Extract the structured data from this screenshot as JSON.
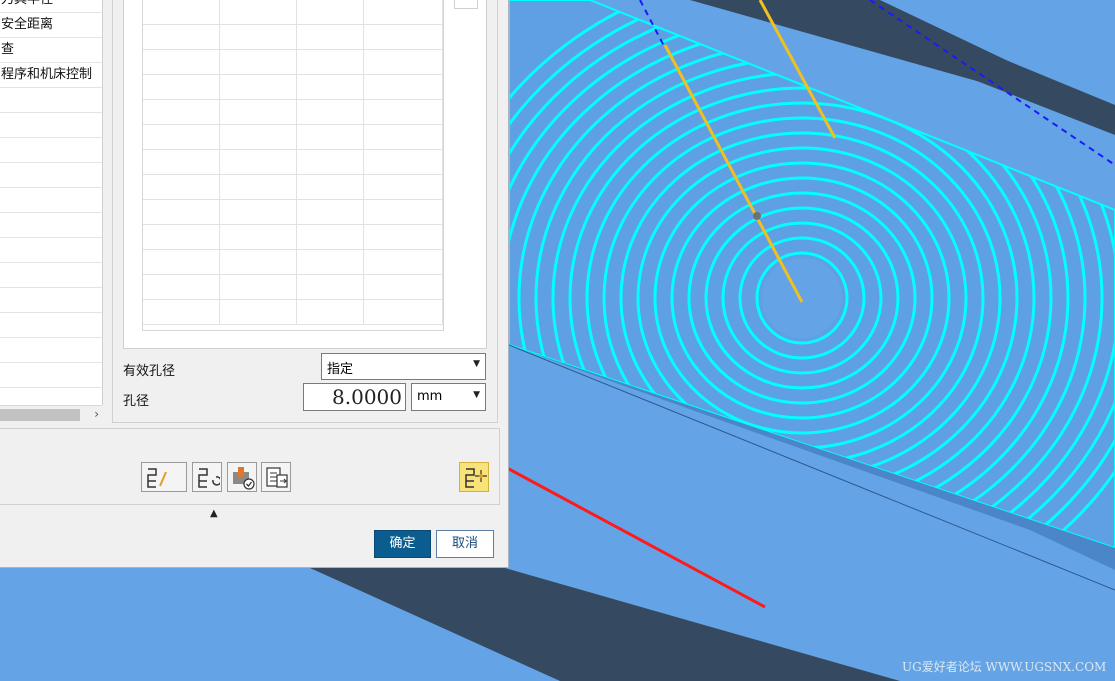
{
  "dialog": {
    "left_list": {
      "items": [
        "刀具半径",
        "安全距离",
        "查",
        "程序和机床控制",
        "",
        "",
        "",
        "",
        "",
        "",
        "",
        "",
        "",
        "",
        "",
        "",
        ""
      ]
    },
    "fields": {
      "effective_hole_label": "有效孔径",
      "effective_hole_value": "指定",
      "hole_diameter_label": "孔径",
      "hole_diameter_value": "8.0000",
      "unit_value": "mm"
    },
    "toolbar": {
      "icons": [
        "generate-icon",
        "replay-icon",
        "verify-icon",
        "list-icon",
        "display-icon"
      ]
    },
    "buttons": {
      "ok_label": "确定",
      "cancel_label": "取消"
    }
  },
  "watermark": "UG爱好者论坛 WWW.UGSNX.COM",
  "colors": {
    "viewport_bg": "#64a4e6",
    "toolpath": "#00ffff",
    "rail": "#354a60",
    "arrow": "#ff1a1a",
    "path_yellow": "#f0c020"
  }
}
